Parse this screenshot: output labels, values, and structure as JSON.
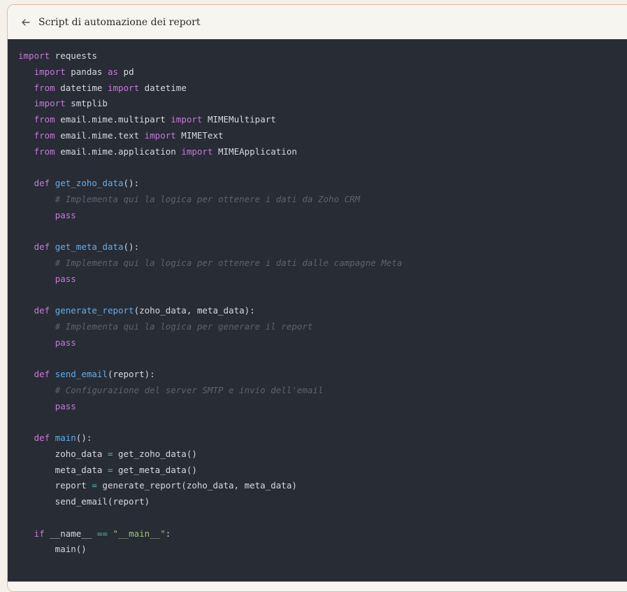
{
  "header": {
    "title": "Script di automazione dei report",
    "back_icon": "arrow-left-icon"
  },
  "code": {
    "language": "python",
    "lines": [
      "import requests",
      "   import pandas as pd",
      "   from datetime import datetime",
      "   import smtplib",
      "   from email.mime.multipart import MIMEMultipart",
      "   from email.mime.text import MIMEText",
      "   from email.mime.application import MIMEApplication",
      "",
      "   def get_zoho_data():",
      "       # Implementa qui la logica per ottenere i dati da Zoho CRM",
      "       pass",
      "",
      "   def get_meta_data():",
      "       # Implementa qui la logica per ottenere i dati dalle campagne Meta",
      "       pass",
      "",
      "   def generate_report(zoho_data, meta_data):",
      "       # Implementa qui la logica per generare il report",
      "       pass",
      "",
      "   def send_email(report):",
      "       # Configurazione del server SMTP e invio dell'email",
      "       pass",
      "",
      "   def main():",
      "       zoho_data = get_zoho_data()",
      "       meta_data = get_meta_data()",
      "       report = generate_report(zoho_data, meta_data)",
      "       send_email(report)",
      "",
      "   if __name__ == \"__main__\":",
      "       main()"
    ]
  },
  "colors": {
    "code_background": "#282c34",
    "keyword": "#c678dd",
    "function": "#61afef",
    "string": "#98c379",
    "comment": "#5c6370",
    "operator": "#56b6c2",
    "text": "#d6d9de"
  }
}
